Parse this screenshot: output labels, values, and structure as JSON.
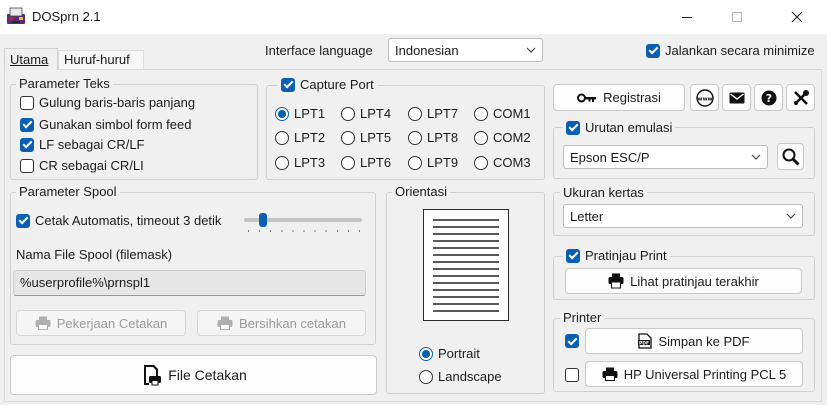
{
  "window": {
    "title": "DOSprn 2.1",
    "icons": {
      "app": "dosprn-app-icon",
      "minimize": "minimize-icon",
      "maximize": "maximize-icon",
      "close": "close-icon"
    }
  },
  "tabs": [
    {
      "label": "Utama",
      "active": true
    },
    {
      "label": "Huruf-huruf",
      "active": false
    }
  ],
  "header": {
    "interface_language_label": "Interface language",
    "interface_language_value": "Indonesian",
    "run_minimized_label": "Jalankan secara minimize",
    "run_minimized_checked": true
  },
  "text_params": {
    "title": "Parameter Teks",
    "options": [
      {
        "label": "Gulung baris-baris panjang",
        "checked": false
      },
      {
        "label": "Gunakan simbol form feed",
        "checked": true
      },
      {
        "label": "LF sebagai CR/LF",
        "checked": true
      },
      {
        "label": "CR sebagai CR/LI",
        "checked": false
      }
    ]
  },
  "capture_port": {
    "label": "Capture Port",
    "checked": true,
    "ports": [
      "LPT1",
      "LPT4",
      "LPT7",
      "COM1",
      "LPT2",
      "LPT5",
      "LPT8",
      "COM2",
      "LPT3",
      "LPT6",
      "LPT9",
      "COM3"
    ],
    "selected": "LPT1"
  },
  "top_buttons": {
    "registrasi": "Registrasi",
    "icons": [
      "key-icon",
      "www-icon",
      "mail-icon",
      "help-icon",
      "tools-icon"
    ]
  },
  "emulation": {
    "label": "Urutan emulasi",
    "checked": true,
    "value": "Epson ESC/P",
    "search_icon": "search-icon"
  },
  "spool": {
    "title": "Parameter Spool",
    "auto_print_label": "Cetak Automatis, timeout 3 detik",
    "auto_print_checked": true,
    "timeout_level": 0.1,
    "file_label": "Nama File Spool (filemask)",
    "file_value": "%userprofile%\\prnspl1",
    "jobs_button": "Pekerjaan Cetakan",
    "clear_button": "Bersihkan cetakan"
  },
  "print_file_button": "File Cetakan",
  "orientation": {
    "title": "Orientasi",
    "options": [
      {
        "label": "Portrait",
        "selected": true
      },
      {
        "label": "Landscape",
        "selected": false
      }
    ]
  },
  "paper": {
    "title": "Ukuran kertas",
    "value": "Letter"
  },
  "preview": {
    "label": "Pratinjau Print",
    "checked": true,
    "button": "Lihat pratinjau terakhir"
  },
  "printer": {
    "title": "Printer",
    "pdf_label": "Simpan ke PDF",
    "pdf_checked": true,
    "device_label": "HP Universal Printing PCL 5",
    "device_checked": false
  },
  "colors": {
    "accent": "#0a5fb4",
    "panel": "#f0f0f0",
    "border": "#d0d0d0"
  }
}
